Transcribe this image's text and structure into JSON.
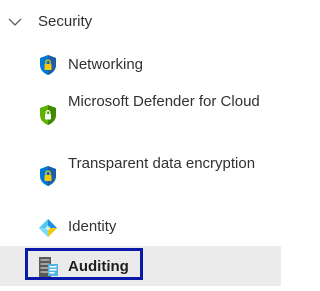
{
  "group": {
    "label": "Security",
    "expanded": true,
    "icon": "chevron-down-icon"
  },
  "items": [
    {
      "label": "Networking",
      "icon": "shield-lock-icon",
      "selected": false
    },
    {
      "label": "Microsoft Defender for Cloud",
      "icon": "defender-shield-icon",
      "selected": false
    },
    {
      "label": "Transparent data encryption",
      "icon": "shield-lock-icon",
      "selected": false
    },
    {
      "label": "Identity",
      "icon": "identity-diamond-icon",
      "selected": false
    },
    {
      "label": "Auditing",
      "icon": "auditing-icon",
      "selected": true
    }
  ],
  "colors": {
    "selected_background": "#ebebeb",
    "focus_outline": "#0a1aa8",
    "shield_blue": "#0078d4",
    "lock_gold": "#f2c811",
    "defender_green": "#5db300"
  }
}
